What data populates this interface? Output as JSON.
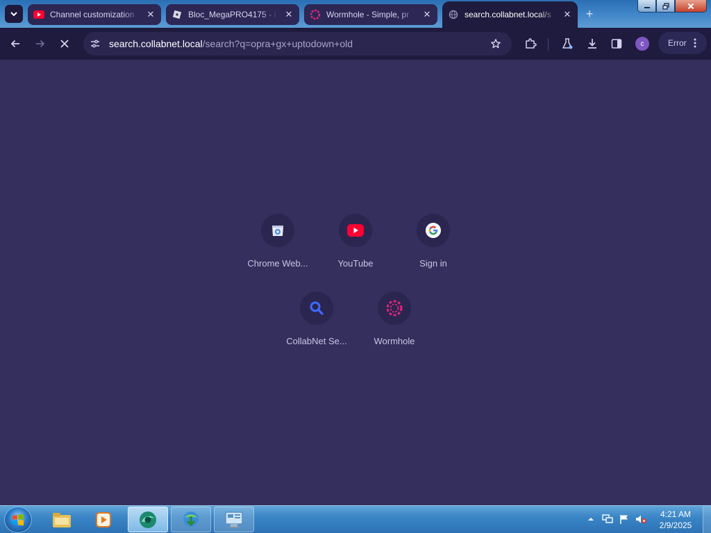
{
  "browser": {
    "tabs": [
      {
        "title": "Channel customization",
        "favicon": "youtube-icon",
        "active": false
      },
      {
        "title": "Bloc_MegaPRO4175 - I",
        "favicon": "roblox-icon",
        "active": false
      },
      {
        "title": "Wormhole - Simple, pr",
        "favicon": "wormhole-icon",
        "active": false
      },
      {
        "title": "search.collabnet.local/s",
        "favicon": "globe-icon",
        "active": true
      }
    ],
    "new_tab_label": "+",
    "tab_close_glyph": "✕",
    "address": {
      "host": "search.collabnet.local",
      "path": "/search?q=opra+gx+uptodown+old"
    },
    "profile_initial": "c",
    "error_label": "Error"
  },
  "shortcuts": [
    {
      "label": "Chrome Web...",
      "icon": "chrome-web-store-icon"
    },
    {
      "label": "YouTube",
      "icon": "youtube-icon"
    },
    {
      "label": "Sign in",
      "icon": "google-icon"
    },
    {
      "label": "CollabNet Se...",
      "icon": "search-icon"
    },
    {
      "label": "Wormhole",
      "icon": "wormhole-icon"
    }
  ],
  "taskbar": {
    "apps": [
      "file-explorer-icon",
      "media-player-icon",
      "browser-icon",
      "internet-download-icon",
      "control-panel-icon"
    ],
    "clock": {
      "time": "4:21 AM",
      "date": "2/9/2025"
    }
  },
  "colors": {
    "page_bg": "#342f5c",
    "toolbar_bg": "#1e1b3e",
    "accent_youtube": "#ff0033",
    "accent_wormhole": "#e2247b",
    "accent_collabnet": "#3d6bff"
  }
}
